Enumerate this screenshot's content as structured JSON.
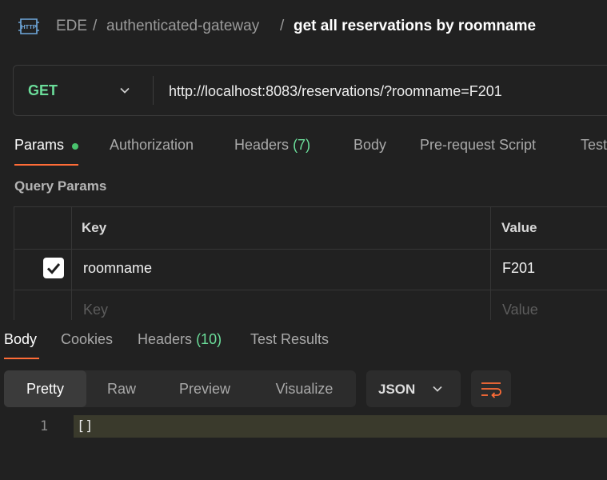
{
  "breadcrumb": {
    "icon": "http-icon",
    "items": [
      "EDE",
      "authenticated-gateway"
    ],
    "separator": "/",
    "current": "get all reservations by roomname"
  },
  "request": {
    "method": "GET",
    "url": "http://localhost:8083/reservations/?roomname=F201"
  },
  "request_tabs": [
    {
      "label": "Params",
      "active": true,
      "indicator": "green-dot"
    },
    {
      "label": "Authorization"
    },
    {
      "label": "Headers",
      "count": "(7)"
    },
    {
      "label": "Body"
    },
    {
      "label": "Pre-request Script"
    },
    {
      "label": "Test"
    }
  ],
  "query_params": {
    "heading": "Query Params",
    "columns": [
      "Key",
      "Value"
    ],
    "rows": [
      {
        "checked": true,
        "key": "roomname",
        "value": "F201"
      }
    ],
    "placeholder_row": {
      "key": "Key",
      "value": "Value"
    }
  },
  "response": {
    "tabs": [
      {
        "label": "Body",
        "active": true
      },
      {
        "label": "Cookies"
      },
      {
        "label": "Headers",
        "count": "(10)"
      },
      {
        "label": "Test Results"
      }
    ],
    "view_modes": [
      "Pretty",
      "Raw",
      "Preview",
      "Visualize"
    ],
    "active_view": "Pretty",
    "format": "JSON",
    "lines": [
      {
        "number": "1",
        "text": "[]"
      }
    ]
  },
  "colors": {
    "background": "#212121",
    "accent": "#ff6c37",
    "method_get": "#6bdd9a",
    "count": "#6bdd9a",
    "dot": "#49c36d"
  }
}
